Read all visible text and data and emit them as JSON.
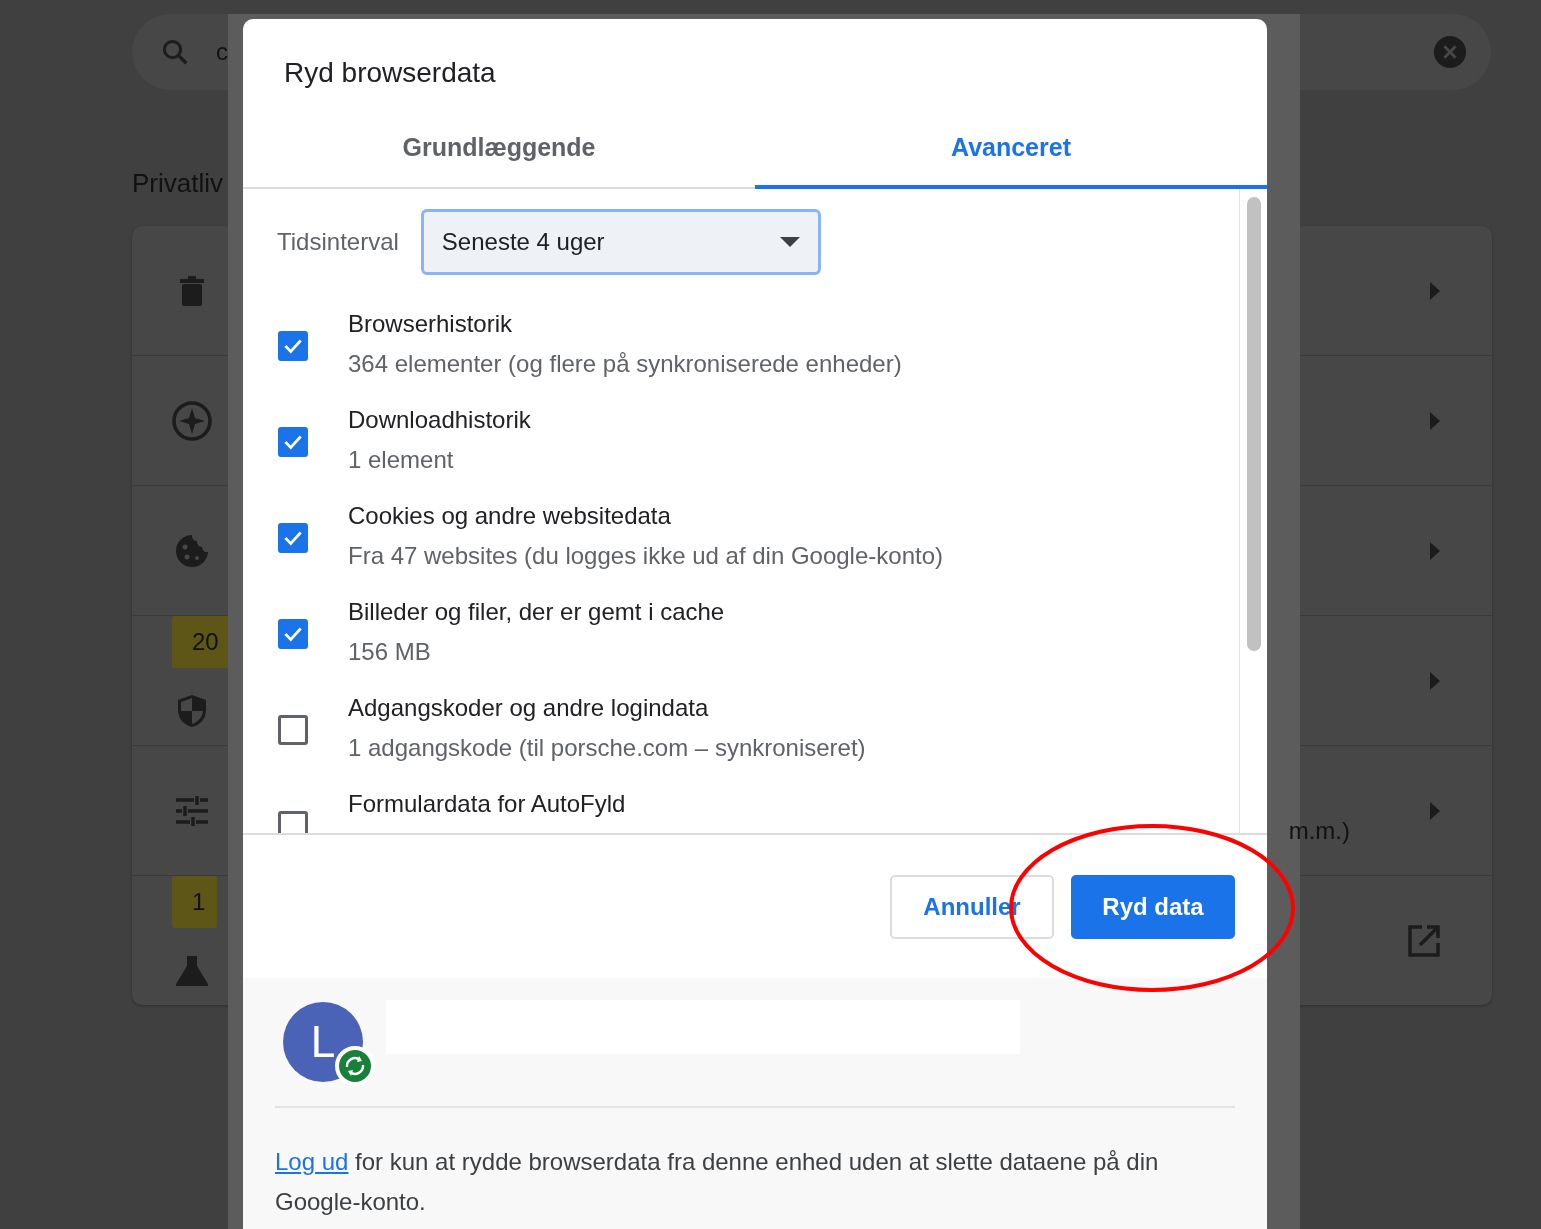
{
  "background_page": {
    "search": {
      "value": "c"
    },
    "heading": "Privatliv",
    "rows": [
      {
        "kind": "arrow"
      },
      {
        "kind": "arrow"
      },
      {
        "kind": "arrow"
      },
      {
        "kind": "arrow",
        "badge": "20"
      },
      {
        "kind": "arrow",
        "text": "m.m.)"
      },
      {
        "kind": "external",
        "badge": "1"
      }
    ]
  },
  "dialog": {
    "title": "Ryd browserdata",
    "tabs": [
      {
        "label": "Grundlæggende",
        "selected": false
      },
      {
        "label": "Avanceret",
        "selected": true
      }
    ],
    "time_range": {
      "label": "Tidsinterval",
      "value": "Seneste 4 uger"
    },
    "items": [
      {
        "title": "Browserhistorik",
        "detail": "364 elementer (og flere på synkroniserede enheder)",
        "checked": true
      },
      {
        "title": "Downloadhistorik",
        "detail": "1 element",
        "checked": true
      },
      {
        "title": "Cookies og andre websitedata",
        "detail": "Fra 47 websites (du logges ikke ud af din Google-konto)",
        "checked": true
      },
      {
        "title": "Billeder og filer, der er gemt i cache",
        "detail": "156 MB",
        "checked": true
      },
      {
        "title": "Adgangskoder og andre logindata",
        "detail": "1 adgangskode (til porsche.com – synkroniseret)",
        "checked": false
      },
      {
        "title": "Formulardata for AutoFyld",
        "checked": false
      }
    ],
    "buttons": [
      {
        "label": "Annuller",
        "kind": "secondary"
      },
      {
        "label": "Ryd data",
        "kind": "primary"
      }
    ],
    "account": {
      "initial": "L"
    },
    "signout": {
      "link": "Log ud",
      "text": " for kun at rydde browserdata fra denne enhed uden at slette dataene på din Google-konto."
    }
  }
}
